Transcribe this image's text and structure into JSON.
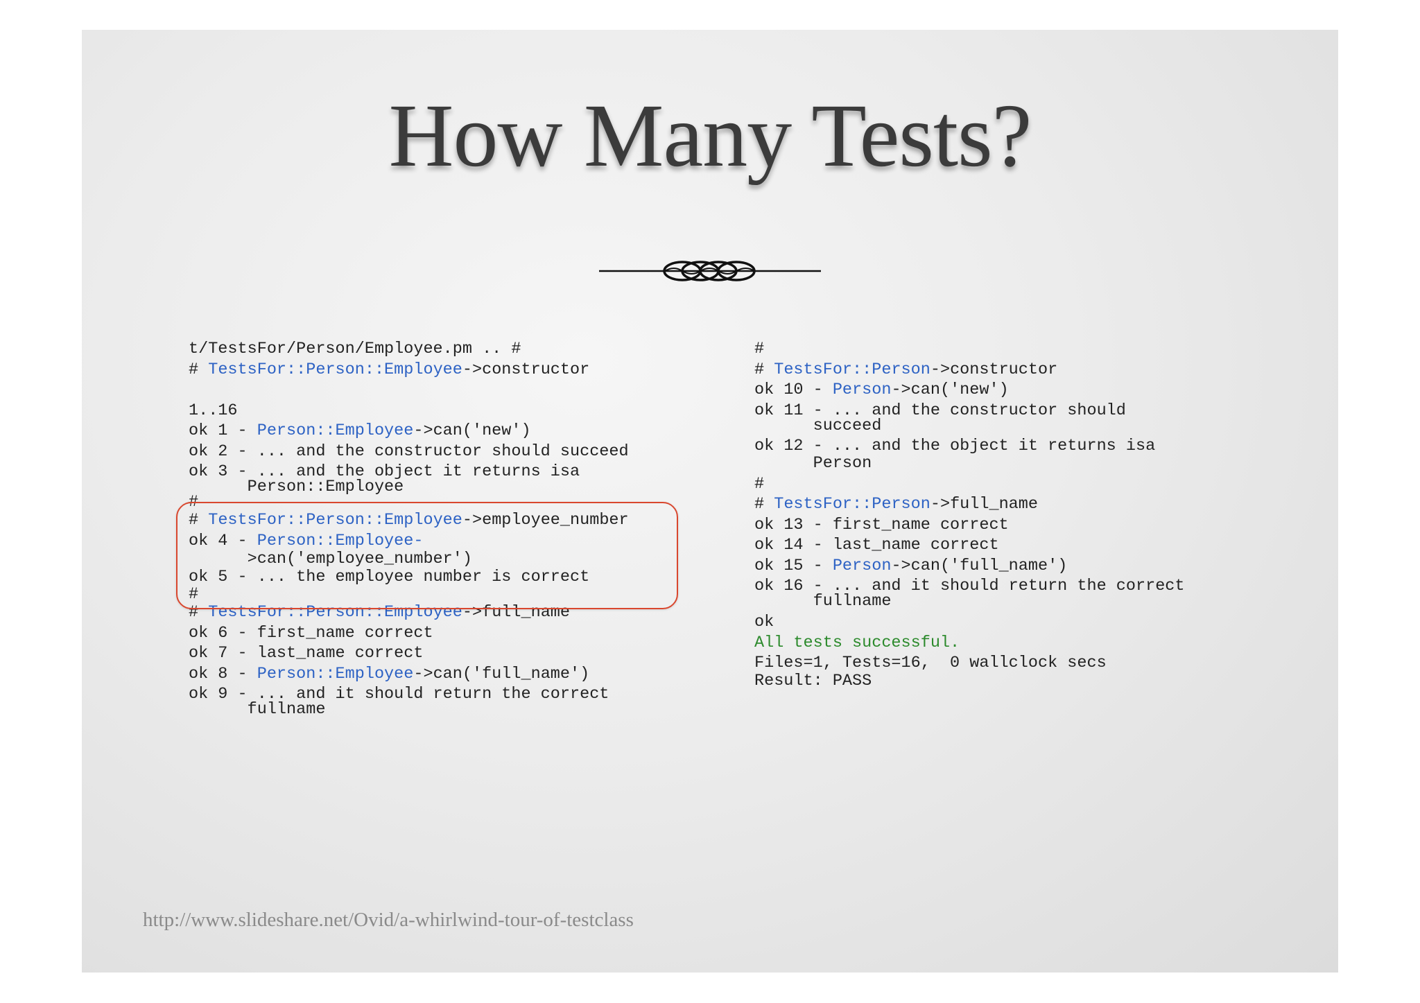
{
  "slide": {
    "title": "How Many Tests?",
    "footer_url": "http://www.slideshare.net/Ovid/a-whirlwind-tour-of-testclass"
  },
  "left_column": {
    "header": "t/TestsFor/Person/Employee.pm .. #",
    "constructor_comment_prefix": "# ",
    "constructor_ns": "TestsFor::Person::Employee",
    "constructor_suffix": "->constructor",
    "plan": "1..16",
    "ok1_prefix": "ok 1 - ",
    "ok1_ns": "Person::Employee",
    "ok1_suffix": "->can('new')",
    "ok2": "ok 2 - ... and the constructor should succeed",
    "ok3_line1": "ok 3 - ... and the object it returns isa",
    "ok3_line2": "      Person::Employee",
    "hash1": "#",
    "empnum_comment_prefix": "# ",
    "empnum_ns": "TestsFor::Person::Employee",
    "empnum_suffix": "->employee_number",
    "ok4_prefix": "ok 4 - ",
    "ok4_ns": "Person::Employee-",
    "ok4_line2": "      >can('employee_number')",
    "ok5": "ok 5 - ... the employee number is correct",
    "hash2": "#",
    "fullname_comment_prefix": "# ",
    "fullname_ns": "TestsFor::Person::Employee",
    "fullname_suffix": "->full_name",
    "ok6": "ok 6 - first_name correct",
    "ok7": "ok 7 - last_name correct",
    "ok8_prefix": "ok 8 - ",
    "ok8_ns": "Person::Employee",
    "ok8_suffix": "->can('full_name')",
    "ok9_line1": "ok 9 - ... and it should return the correct",
    "ok9_line2": "      fullname"
  },
  "right_column": {
    "hash1": "#",
    "constructor_comment_prefix": "# ",
    "constructor_ns": "TestsFor::Person",
    "constructor_suffix": "->constructor",
    "ok10_prefix": "ok 10 - ",
    "ok10_ns": "Person",
    "ok10_suffix": "->can('new')",
    "ok11_line1": "ok 11 - ... and the constructor should",
    "ok11_line2": "      succeed",
    "ok12_line1": "ok 12 - ... and the object it returns isa",
    "ok12_line2": "      Person",
    "hash2": "#",
    "fullname_comment_prefix": "# ",
    "fullname_ns": "TestsFor::Person",
    "fullname_suffix": "->full_name",
    "ok13": "ok 13 - first_name correct",
    "ok14": "ok 14 - last_name correct",
    "ok15_prefix": "ok 15 - ",
    "ok15_ns": "Person",
    "ok15_suffix": "->can('full_name')",
    "ok16_line1": "ok 16 - ... and it should return the correct",
    "ok16_line2": "      fullname",
    "ok": "ok",
    "all_tests": "All tests successful.",
    "files_line": "Files=1, Tests=16,  0 wallclock secs",
    "result": "Result: PASS"
  },
  "colors": {
    "namespace": "#2d62c4",
    "success": "#2c8a2c",
    "highlight_border": "#d9472e",
    "title": "#3b3b3b"
  },
  "icons": {
    "divider": "ornamental-flourish-divider"
  }
}
